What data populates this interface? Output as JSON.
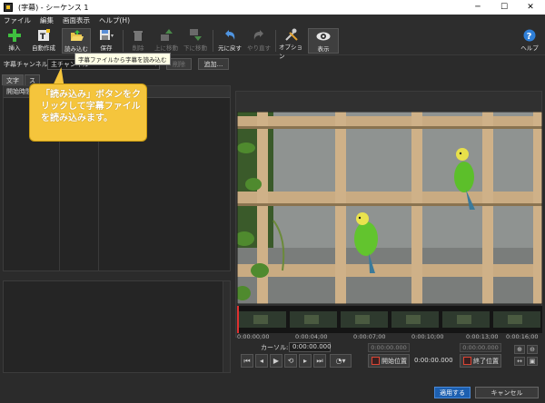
{
  "window": {
    "title": "(字幕) - シーケンス 1",
    "minimize": "─",
    "maximize": "☐",
    "close": "✕"
  },
  "menu": [
    "ファイル",
    "編集",
    "画面表示",
    "ヘルプ(H)"
  ],
  "toolbar": {
    "insert": "挿入",
    "auto_create": "自動作成",
    "load": "読み込む",
    "save": "保存",
    "delete": "削除",
    "move_up": "上に移動",
    "move_down": "下に移動",
    "undo": "元に戻す",
    "redo": "やり直す",
    "options": "オプション",
    "display": "表示",
    "help": "ヘルプ"
  },
  "tooltip": "字幕ファイルから字幕を読み込む",
  "channel": {
    "label": "字幕チャンネル:",
    "selected": "主チャンネル",
    "delete": "削除",
    "add": "追加..."
  },
  "tabs": [
    "文字",
    "ス"
  ],
  "list": {
    "col_start": "開始時間"
  },
  "callout": "「読み込み」ボタンをクリックして字幕ファイルを読み込みます。",
  "timeline": {
    "ticks": [
      "0:00:00;00",
      "0:00:04;00",
      "0:00:07;00",
      "0:00:10;00",
      "0:00:13;00",
      "0:00:16;00"
    ]
  },
  "transport": {
    "cursor_label": "カーソル:",
    "cursor_value": "0:00:00.000",
    "start_box": "0:00:00.000",
    "end_box": "0:00:00.000",
    "start_button": "開始位置",
    "end_button": "終了位置",
    "time_value": "0:00:00.000"
  },
  "dialog": {
    "apply": "適用する",
    "cancel": "キャンセル"
  },
  "colors": {
    "callout": "#f5c53c",
    "apply_button": "#1c5fb0",
    "background": "#2b2b2b"
  }
}
